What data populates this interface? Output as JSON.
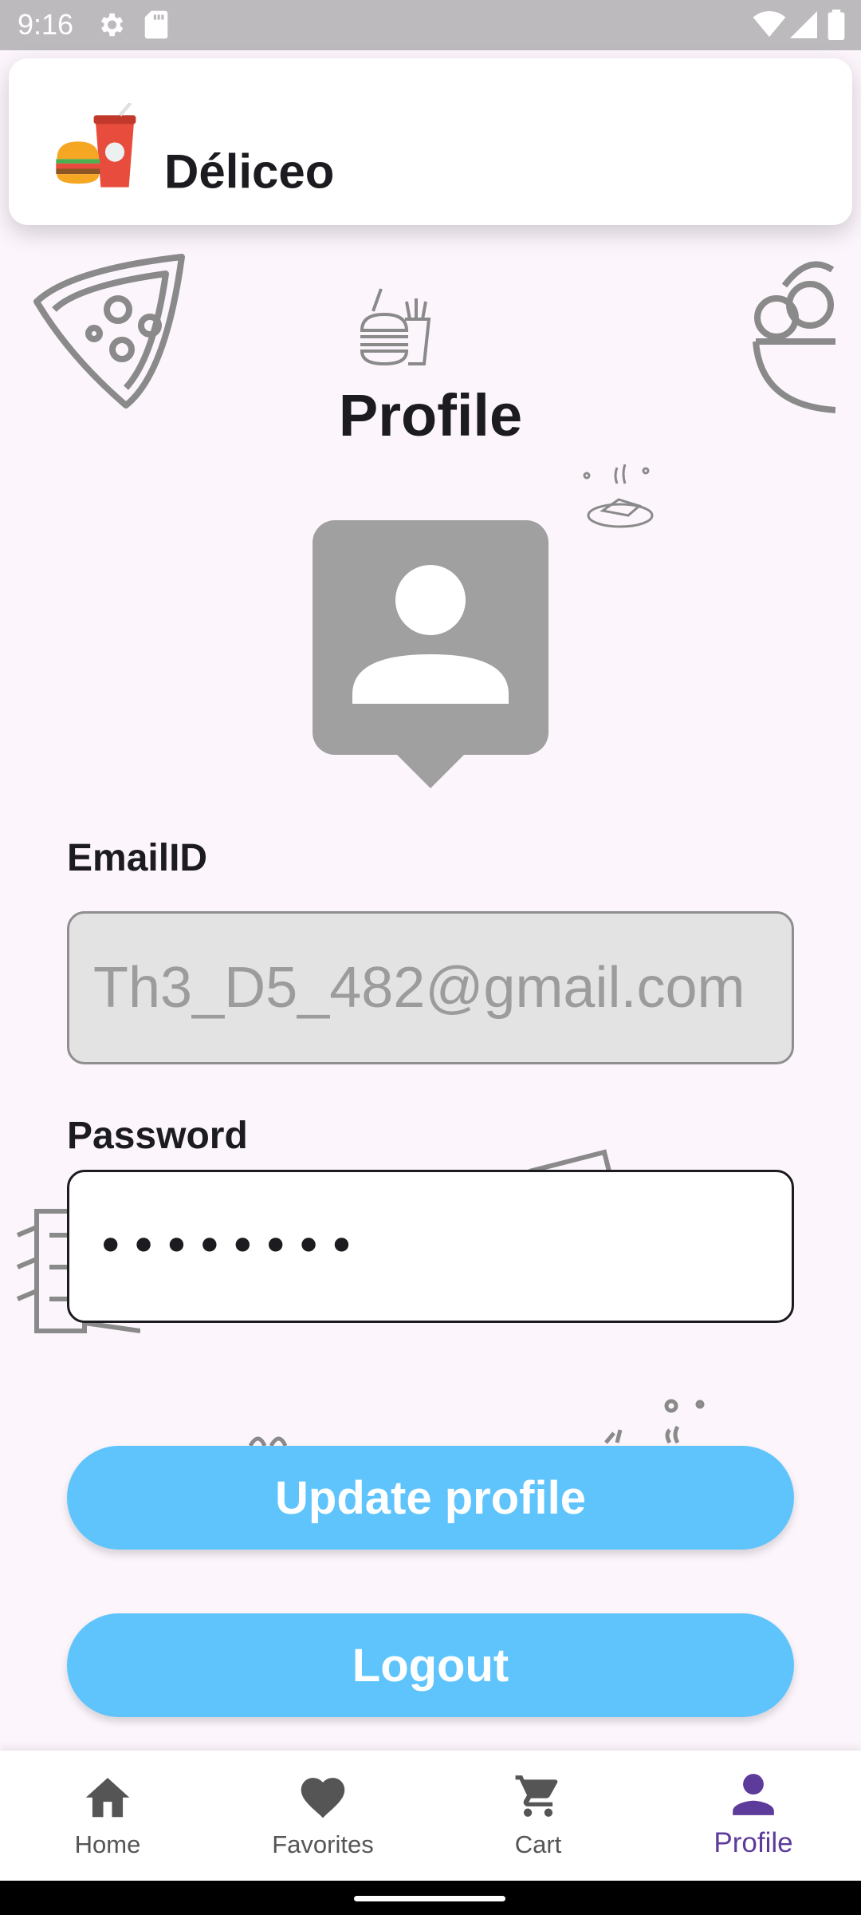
{
  "status_bar": {
    "time": "9:16",
    "icons": [
      "settings-icon",
      "sd-card-icon",
      "wifi-icon",
      "signal-icon",
      "battery-icon"
    ]
  },
  "app_bar": {
    "title": "Déliceo",
    "logo_icon": "burger-drink-logo"
  },
  "page": {
    "title": "Profile",
    "avatar_icon": "person-pin-icon"
  },
  "form": {
    "email_label": "EmailID",
    "email_value": "Th3_D5_482@gmail.com",
    "password_label": "Password",
    "password_value": "••••••••"
  },
  "actions": {
    "update_label": "Update profile",
    "logout_label": "Logout"
  },
  "bottom_nav": {
    "items": [
      {
        "label": "Home",
        "icon": "home-icon"
      },
      {
        "label": "Favorites",
        "icon": "heart-icon"
      },
      {
        "label": "Cart",
        "icon": "cart-icon"
      },
      {
        "label": "Profile",
        "icon": "person-icon"
      }
    ],
    "active": "Profile"
  },
  "colors": {
    "background": "#fcf6fc",
    "button": "#5ec4fb",
    "active_nav": "#5d3b9b",
    "avatar": "#a0a0a0"
  }
}
